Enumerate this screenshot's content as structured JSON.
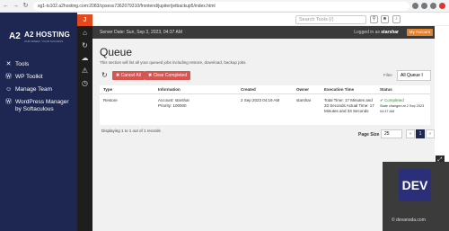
{
  "browser": {
    "url": "sg1-ts102.a2hosting.com:2083/cpsess7362079310/frontend/jupiter/jetbackup5/index.html"
  },
  "topbar": {
    "search_placeholder": "Search Tools (/)"
  },
  "brand": {
    "name": "A2 HOSTING",
    "tagline": "OUR SPEED, YOUR SUCCESS"
  },
  "sidebar": {
    "items": [
      {
        "label": "Tools",
        "icon": "wrench-icon"
      },
      {
        "label": "WP Toolkit",
        "icon": "wordpress-icon"
      },
      {
        "label": "Manage Team",
        "icon": "team-icon"
      },
      {
        "label": "WordPress Manager by Softaculous",
        "icon": "wordpress-icon"
      }
    ]
  },
  "header": {
    "server_date": "Server Date: Sun, Sep 3, 2023, 04:37 AM",
    "logged_prefix": "Logged in as",
    "user": "starshar",
    "my_account": "My Account"
  },
  "page": {
    "title": "Queue",
    "description": "This section will list all your queued jobs including restore, download, backup jobs."
  },
  "toolbar": {
    "cancel_all": "✖ Cancel All",
    "clear_completed": "✖ Clear Completed",
    "filter_label": "Filter",
    "filter_value": "All Queue I"
  },
  "table": {
    "headers": [
      "Type",
      "Information",
      "Created",
      "Owner",
      "Execution Time",
      "Status"
    ],
    "rows": [
      {
        "type": "Restore",
        "info1": "Account: starshar",
        "info2": "Priority: 100000",
        "created": "2 Sep 2023 04:19 AM",
        "owner": "starshar",
        "exec": "Total Time: 17 Minutes and 33 Seconds Actual Time: 17 Minutes and 33 Seconds",
        "status": "✔ Completed",
        "status_detail": "State changed at 2 Sep 2023 04:37 AM"
      }
    ]
  },
  "footer": {
    "summary": "Displaying 1 to 1 out of 1 records",
    "page_size_label": "Page Size",
    "page_size": "25",
    "prev": "«",
    "page": "1",
    "next": "»"
  },
  "badge": {
    "text": "DEV",
    "credit": "© devanoda.com"
  }
}
